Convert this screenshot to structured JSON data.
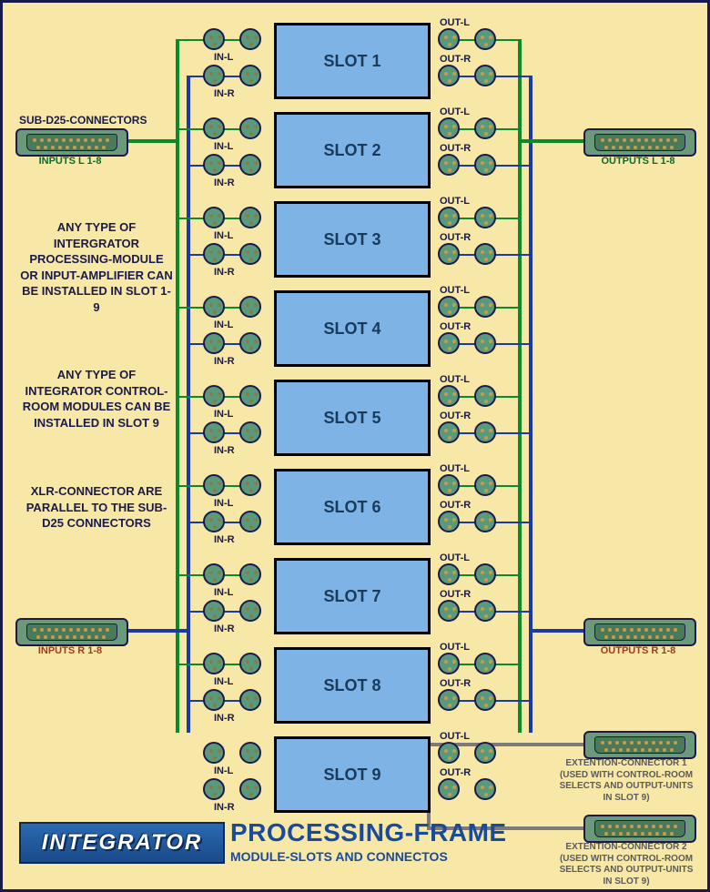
{
  "header": {
    "subd25": "SUB-D25-CONNECTORS"
  },
  "slots": [
    {
      "name": "SLOT 1"
    },
    {
      "name": "SLOT 2"
    },
    {
      "name": "SLOT 3"
    },
    {
      "name": "SLOT 4"
    },
    {
      "name": "SLOT 5"
    },
    {
      "name": "SLOT 6"
    },
    {
      "name": "SLOT 7"
    },
    {
      "name": "SLOT 8"
    },
    {
      "name": "SLOT 9"
    }
  ],
  "io_labels": {
    "inL": "IN-L",
    "inR": "IN-R",
    "outL": "OUT-L",
    "outR": "OUT-R"
  },
  "connectors": {
    "inputsL": "INPUTS L 1-8",
    "inputsR": "INPUTS R 1-8",
    "outputsL": "OUTPUTS L 1-8",
    "outputsR": "OUTPUTS R 1-8",
    "ext1": "EXTENTION-CONNECTOR 1\n(USED WITH CONTROL-ROOM\nSELECTS AND OUTPUT-UNITS\nIN SLOT 9)",
    "ext2": "EXTENTION-CONNECTOR 2\n(USED WITH CONTROL-ROOM\nSELECTS AND OUTPUT-UNITS\nIN SLOT 9)"
  },
  "info": {
    "p1": "ANY TYPE OF INTERGRATOR PROCESSING-MODULE OR INPUT-AMPLIFIER CAN BE INSTALLED IN SLOT 1-9",
    "p2": "ANY TYPE OF INTEGRATOR CONTROL-ROOM MODULES CAN BE INSTALLED IN SLOT 9",
    "p3": "XLR-CONNECTOR ARE  PARALLEL TO THE SUB-D25 CONNECTORS"
  },
  "title": {
    "main": "PROCESSING-FRAME",
    "sub": "MODULE-SLOTS AND CONNECTOS"
  },
  "logo": "INTEGRATOR",
  "colors": {
    "busGreen": "#0a8a2a",
    "busBlue": "#1a3aaa",
    "busGrey": "#7a7a7a",
    "frameBg": "#f8e8a8",
    "slotBg": "#7db3e5",
    "xlrBg": "#5a9a7a"
  }
}
